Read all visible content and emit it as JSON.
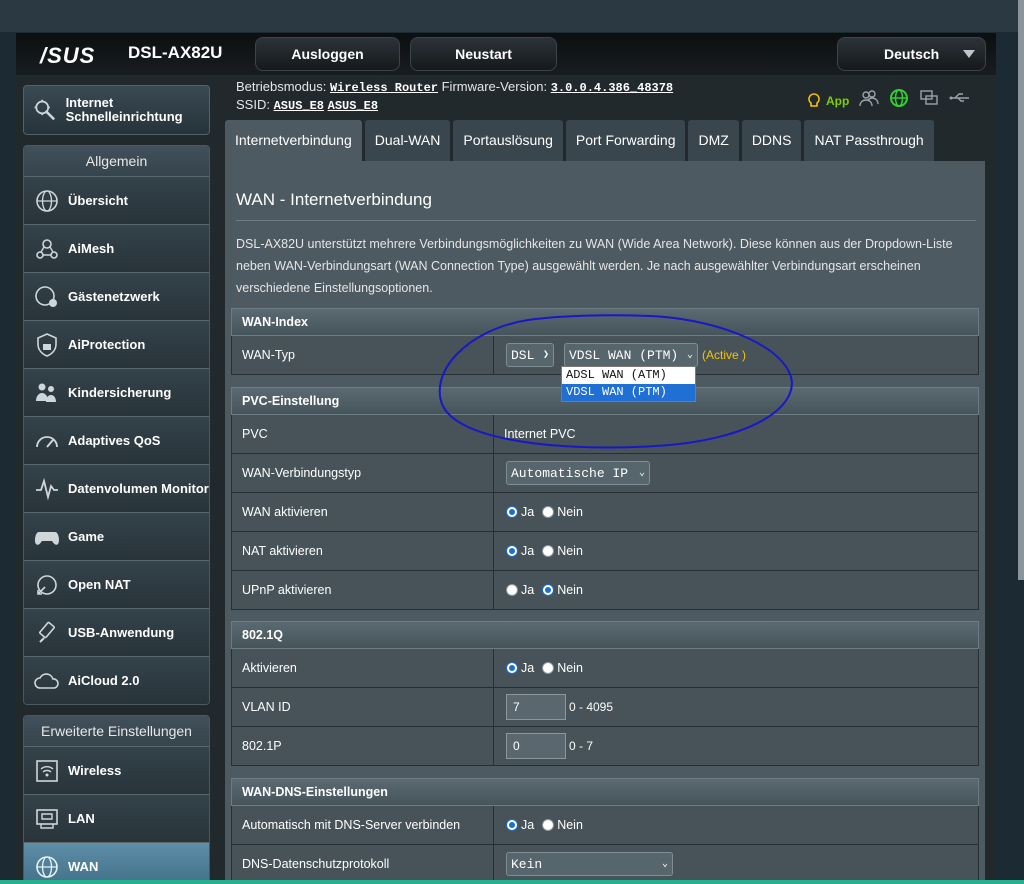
{
  "brand": {
    "logo": "/SUS",
    "model": "DSL-AX82U"
  },
  "topbar": {
    "logout": "Ausloggen",
    "restart": "Neustart",
    "language": "Deutsch"
  },
  "info": {
    "mode_label": "Betriebsmodus:",
    "mode_value": "Wireless Router",
    "fw_label": "Firmware-Version:",
    "fw_value": "3.0.0.4.386_48378",
    "ssid_label": "SSID:",
    "ssid1": "ASUS_E8",
    "ssid2": "ASUS_E8",
    "app_label": "App"
  },
  "sidebar": {
    "quick_setup": "Internet Schnelleinrichtung",
    "general_title": "Allgemein",
    "general": [
      {
        "label": "Übersicht",
        "icon": "globe-icon"
      },
      {
        "label": "AiMesh",
        "icon": "mesh-icon"
      },
      {
        "label": "Gästenetzwerk",
        "icon": "guest-network-icon"
      },
      {
        "label": "AiProtection",
        "icon": "lock-shield-icon"
      },
      {
        "label": "Kindersicherung",
        "icon": "family-icon"
      },
      {
        "label": "Adaptives QoS",
        "icon": "speedometer-icon"
      },
      {
        "label": "Datenvolumen Monitor",
        "icon": "traffic-monitor-icon"
      },
      {
        "label": "Game",
        "icon": "gamepad-icon"
      },
      {
        "label": "Open NAT",
        "icon": "open-nat-icon"
      },
      {
        "label": "USB-Anwendung",
        "icon": "usb-icon"
      },
      {
        "label": "AiCloud 2.0",
        "icon": "cloud-icon"
      }
    ],
    "advanced_title": "Erweiterte Einstellungen",
    "advanced": [
      {
        "label": "Wireless",
        "icon": "wifi-icon"
      },
      {
        "label": "LAN",
        "icon": "lan-icon"
      },
      {
        "label": "WAN",
        "icon": "wan-globe-icon"
      }
    ]
  },
  "tabs": [
    "Internetverbindung",
    "Dual-WAN",
    "Portauslösung",
    "Port Forwarding",
    "DMZ",
    "DDNS",
    "NAT Passthrough"
  ],
  "page": {
    "title": "WAN - Internetverbindung",
    "description": "DSL-AX82U unterstützt mehrere Verbindungsmöglichkeiten zu WAN (Wide Area Network). Diese können aus der Dropdown-Liste neben WAN-Verbindungsart (WAN Connection Type) ausgewählt werden. Je nach ausgewählter Verbindungsart erscheinen verschiedene Einstellungsoptionen."
  },
  "wan_index": {
    "header": "WAN-Index",
    "label": "WAN-Typ",
    "type": "DSL",
    "mode": "VDSL WAN (PTM)",
    "status": "(Active )",
    "options": [
      "ADSL WAN (ATM)",
      "VDSL WAN (PTM)"
    ]
  },
  "pvc": {
    "header": "PVC-Einstellung",
    "pvc_label": "PVC",
    "pvc_value": "Internet PVC",
    "conn_label": "WAN-Verbindungstyp",
    "conn_value": "Automatische IP",
    "wan_enable_label": "WAN aktivieren",
    "nat_enable_label": "NAT aktivieren",
    "upnp_label": "UPnP aktivieren",
    "yes": "Ja",
    "no": "Nein"
  },
  "dot1q": {
    "header": "802.1Q",
    "enable_label": "Aktivieren",
    "vlan_label": "VLAN ID",
    "vlan_value": "7",
    "vlan_range": "0 - 4095",
    "prio_label": "802.1P",
    "prio_value": "0",
    "prio_range": "0 - 7"
  },
  "dns": {
    "header": "WAN-DNS-Einstellungen",
    "auto_label": "Automatisch mit DNS-Server verbinden",
    "privacy_label": "DNS-Datenschutzprotokoll",
    "privacy_value": "Kein"
  },
  "colors": {
    "accent": "#1f6fd4",
    "active": "#f5c400",
    "annotation": "#1818c8",
    "app_green": "#7ccf00"
  }
}
